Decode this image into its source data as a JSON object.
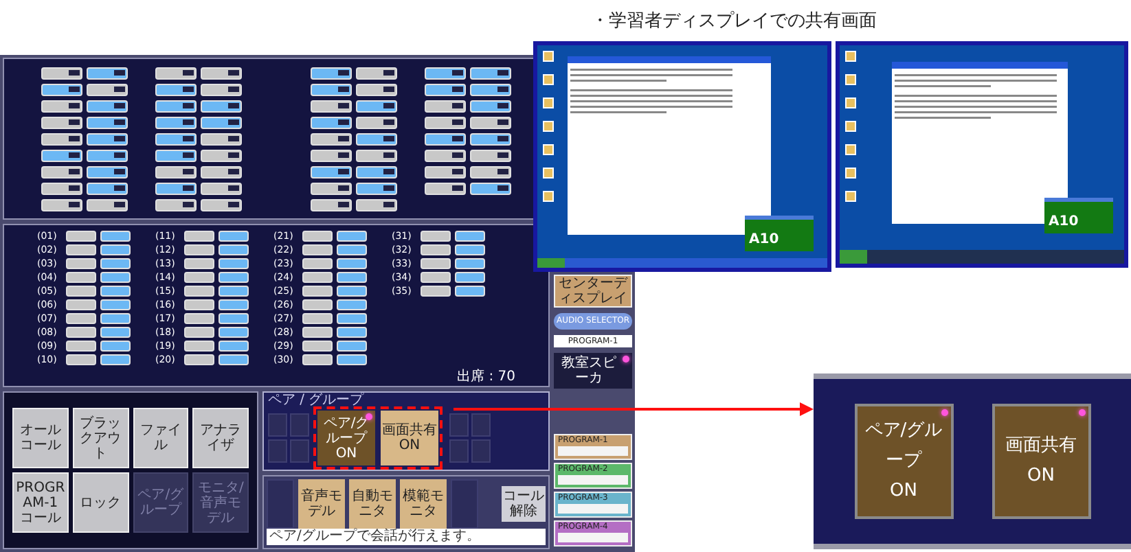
{
  "seat_map": {
    "groups": [
      {
        "columns": [
          [
            false,
            true,
            false,
            false,
            false,
            true,
            false,
            false,
            false
          ],
          [
            true,
            false,
            true,
            true,
            true,
            true,
            true,
            true,
            false
          ]
        ]
      },
      {
        "columns": [
          [
            false,
            true,
            true,
            true,
            true,
            true,
            false,
            true,
            false
          ],
          [
            false,
            false,
            true,
            true,
            false,
            false,
            false,
            false,
            false
          ]
        ]
      },
      {
        "columns": [
          [
            true,
            true,
            false,
            true,
            false,
            false,
            true,
            false,
            false
          ],
          [
            false,
            false,
            true,
            false,
            true,
            false,
            true,
            true,
            false
          ]
        ]
      },
      {
        "columns": [
          [
            true,
            true,
            false,
            false,
            true,
            false,
            false,
            false
          ],
          [
            true,
            true,
            true,
            false,
            true,
            false,
            false,
            true
          ]
        ]
      }
    ]
  },
  "pair_list": {
    "columns": [
      {
        "rows": [
          {
            "label": "(01)"
          },
          {
            "label": "(02)"
          },
          {
            "label": "(03)"
          },
          {
            "label": "(04)"
          },
          {
            "label": "(05)"
          },
          {
            "label": "(06)"
          },
          {
            "label": "(07)"
          },
          {
            "label": "(08)"
          },
          {
            "label": "(09)"
          },
          {
            "label": "(10)"
          }
        ]
      },
      {
        "rows": [
          {
            "label": "(11)"
          },
          {
            "label": "(12)"
          },
          {
            "label": "(13)"
          },
          {
            "label": "(14)"
          },
          {
            "label": "(15)"
          },
          {
            "label": "(16)"
          },
          {
            "label": "(17)"
          },
          {
            "label": "(18)"
          },
          {
            "label": "(19)"
          },
          {
            "label": "(20)"
          }
        ]
      },
      {
        "rows": [
          {
            "label": "(21)"
          },
          {
            "label": "(22)"
          },
          {
            "label": "(23)"
          },
          {
            "label": "(24)"
          },
          {
            "label": "(25)"
          },
          {
            "label": "(26)"
          },
          {
            "label": "(27)"
          },
          {
            "label": "(28)"
          },
          {
            "label": "(29)"
          },
          {
            "label": "(30)"
          }
        ]
      },
      {
        "rows": [
          {
            "label": "(31)"
          },
          {
            "label": "(32)"
          },
          {
            "label": "(33)"
          },
          {
            "label": "(34)"
          },
          {
            "label": "(35)"
          }
        ]
      }
    ],
    "attendance": "出席 : 70"
  },
  "control_buttons": [
    {
      "label": "オールコール",
      "disabled": false
    },
    {
      "label": "ブラックアウト",
      "disabled": false
    },
    {
      "label": "ファイル",
      "disabled": false
    },
    {
      "label": "アナライザ",
      "disabled": false
    },
    {
      "label": "PROGRAM-1\nコール",
      "disabled": false
    },
    {
      "label": "ロック",
      "disabled": false
    },
    {
      "label": "ペア/グループ",
      "disabled": true
    },
    {
      "label": "モニタ/\n音声モデル",
      "disabled": true
    }
  ],
  "pair_panel": {
    "title": "ペア / グループ",
    "toggles": [
      {
        "label": "ペア/グループ",
        "state": "ON",
        "lit": true,
        "selected": true
      },
      {
        "label": "画面共有",
        "state": "ON",
        "lit": false,
        "selected": false
      }
    ]
  },
  "function_buttons": [
    {
      "label": "音声モデル"
    },
    {
      "label": "自動モニタ"
    },
    {
      "label": "模範モニタ"
    }
  ],
  "call_release": "コール解除",
  "status_message": "ペア/グループで会話が行えます。",
  "side_panel": {
    "display_button": "センターディスプレイ",
    "audio_selector": "AUDIO SELECTOR",
    "program_field": "PROGRAM-1",
    "speaker": {
      "label": "教室スピーカ",
      "lit": true
    },
    "programs": [
      {
        "label": "PROGRAM-1",
        "color": "#c8a070"
      },
      {
        "label": "PROGRAM-2",
        "color": "#5cb86a"
      },
      {
        "label": "PROGRAM-3",
        "color": "#6ab4cc"
      },
      {
        "label": "PROGRAM-4",
        "color": "#b46ec4"
      }
    ]
  },
  "shared_screen": {
    "caption": "・学習者ディスプレイでの共有画面",
    "displays": [
      {
        "kind": "xp",
        "popup": "A10"
      },
      {
        "kind": "vista",
        "popup": "A10"
      }
    ]
  },
  "zoom_inset": {
    "toggles": [
      {
        "label": "ペア/グループ",
        "state": "ON",
        "lit": true
      },
      {
        "label": "画面共有",
        "state": "ON",
        "lit": true
      }
    ]
  }
}
